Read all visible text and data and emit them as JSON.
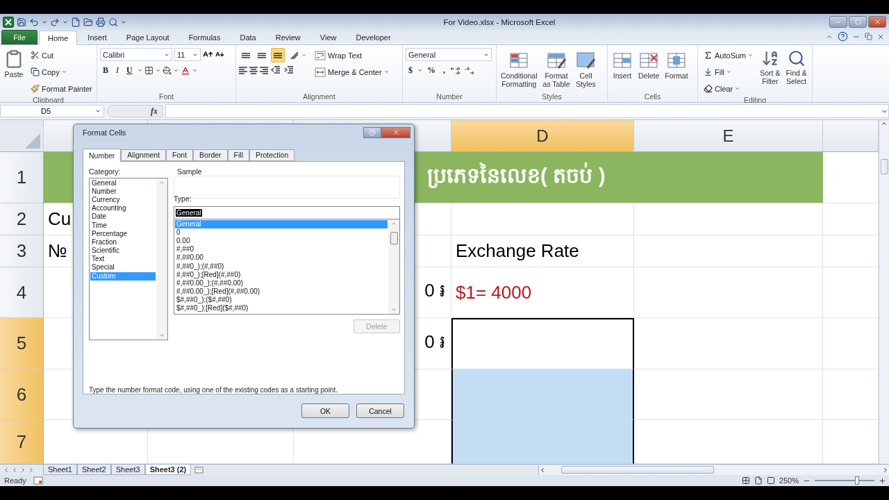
{
  "title_bar": {
    "title": "For Video.xlsx - Microsoft Excel"
  },
  "ribbon_tabs": [
    {
      "label": "File",
      "kind": "file",
      "selected": false
    },
    {
      "label": "Home",
      "kind": "tab",
      "selected": true
    },
    {
      "label": "Insert",
      "kind": "tab",
      "selected": false
    },
    {
      "label": "Page Layout",
      "kind": "tab",
      "selected": false
    },
    {
      "label": "Formulas",
      "kind": "tab",
      "selected": false
    },
    {
      "label": "Data",
      "kind": "tab",
      "selected": false
    },
    {
      "label": "Review",
      "kind": "tab",
      "selected": false
    },
    {
      "label": "View",
      "kind": "tab",
      "selected": false
    },
    {
      "label": "Developer",
      "kind": "tab",
      "selected": false
    }
  ],
  "ribbon": {
    "clipboard": {
      "label": "Clipboard",
      "paste": "Paste",
      "cut": "Cut",
      "copy": "Copy",
      "format_painter": "Format Painter"
    },
    "font": {
      "label": "Font",
      "family": "Calibri",
      "size": "11",
      "bold": "B",
      "italic": "I",
      "underline": "U"
    },
    "alignment": {
      "label": "Alignment",
      "wrap_text": "Wrap Text",
      "merge_center": "Merge & Center",
      "vertical_align": [
        {
          "selected": false
        },
        {
          "selected": false
        },
        {
          "selected": true
        }
      ]
    },
    "number": {
      "label": "Number",
      "format": "General",
      "currency": "$",
      "percent": "%",
      "comma": ","
    },
    "styles": {
      "label": "Styles",
      "buttons": [
        {
          "label": "Conditional\nFormatting",
          "kind": "conditional"
        },
        {
          "label": "Format\nas Table",
          "kind": "table"
        },
        {
          "label": "Cell\nStyles",
          "kind": "cellstyles"
        }
      ]
    },
    "cells": {
      "label": "Cells",
      "buttons": [
        {
          "label": "Insert",
          "kind": "insert"
        },
        {
          "label": "Delete",
          "kind": "delete"
        },
        {
          "label": "Format",
          "kind": "format"
        }
      ]
    },
    "editing": {
      "label": "Editing",
      "autosum": "AutoSum",
      "fill": "Fill",
      "clear": "Clear",
      "sort_filter": "Sort &\nFilter",
      "find_select": "Find &\nSelect"
    }
  },
  "formula_bar": {
    "name_box": "D5",
    "function_label": "fx"
  },
  "sheet": {
    "columns": [
      {
        "label": "D",
        "selected": true
      },
      {
        "label": "E",
        "selected": false
      }
    ],
    "title_row": {
      "header": "1",
      "text": "ប្រភេទនៃលេខ( តចប់ )"
    },
    "rows": [
      {
        "header": "2",
        "selected": false,
        "active": false,
        "column_a": {
          "text": "Cu"
        }
      },
      {
        "header": "3",
        "selected": false,
        "active": false,
        "column_a": {
          "text": "№"
        },
        "column_d": {
          "text": "Exchange Rate"
        }
      },
      {
        "header": "4",
        "selected": false,
        "active": false,
        "column_c": {
          "text": "0 ៛"
        },
        "column_d": {
          "text": "$1= 4000",
          "color": "#c0161c"
        }
      },
      {
        "header": "5",
        "selected": true,
        "active": true,
        "column_c": {
          "text": "0 ៛"
        }
      },
      {
        "header": "6",
        "selected": true,
        "active": false
      },
      {
        "header": "7",
        "selected": true,
        "active": false
      }
    ]
  },
  "dialog": {
    "title": "Format Cells",
    "tabs": [
      {
        "label": "Number",
        "selected": true
      },
      {
        "label": "Alignment",
        "selected": false
      },
      {
        "label": "Font",
        "selected": false
      },
      {
        "label": "Border",
        "selected": false
      },
      {
        "label": "Fill",
        "selected": false
      },
      {
        "label": "Protection",
        "selected": false
      }
    ],
    "category_label": "Category:",
    "categories": [
      {
        "label": "General",
        "selected": false
      },
      {
        "label": "Number",
        "selected": false
      },
      {
        "label": "Currency",
        "selected": false
      },
      {
        "label": "Accounting",
        "selected": false
      },
      {
        "label": "Date",
        "selected": false
      },
      {
        "label": "Time",
        "selected": false
      },
      {
        "label": "Percentage",
        "selected": false
      },
      {
        "label": "Fraction",
        "selected": false
      },
      {
        "label": "Scientific",
        "selected": false
      },
      {
        "label": "Text",
        "selected": false
      },
      {
        "label": "Special",
        "selected": false
      },
      {
        "label": "Custom",
        "selected": true
      }
    ],
    "sample_label": "Sample",
    "type_label": "Type:",
    "type_value": "General",
    "types": [
      {
        "label": "General",
        "selected": true
      },
      {
        "label": "0",
        "selected": false
      },
      {
        "label": "0.00",
        "selected": false
      },
      {
        "label": "#,##0",
        "selected": false
      },
      {
        "label": "#,##0.00",
        "selected": false
      },
      {
        "label": "#,##0_);(#,##0)",
        "selected": false
      },
      {
        "label": "#,##0_);[Red](#,##0)",
        "selected": false
      },
      {
        "label": "#,##0.00_);(#,##0.00)",
        "selected": false
      },
      {
        "label": "#,##0.00_);[Red](#,##0.00)",
        "selected": false
      },
      {
        "label": "$#,##0_);($#,##0)",
        "selected": false
      },
      {
        "label": "$#,##0_);[Red]($#,##0)",
        "selected": false
      }
    ],
    "delete_button": {
      "label": "Delete",
      "disabled": true
    },
    "hint": "Type the number format code, using one of the existing codes as a starting point.",
    "ok": "OK",
    "cancel": "Cancel"
  },
  "sheet_tabs": [
    {
      "label": "Sheet1",
      "selected": false
    },
    {
      "label": "Sheet2",
      "selected": false
    },
    {
      "label": "Sheet3",
      "selected": false
    },
    {
      "label": "Sheet3 (2)",
      "selected": true
    }
  ],
  "status_bar": {
    "status": "Ready",
    "zoom": "250%",
    "zoom_slider": {
      "level": 0.72
    }
  }
}
